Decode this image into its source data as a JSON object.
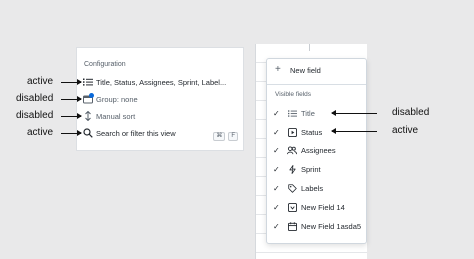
{
  "configuration_menu": {
    "heading": "Configuration",
    "items": [
      {
        "label": "Title, Status, Assignees, Sprint, Label...",
        "icon": "list-icon",
        "annotation": "active"
      },
      {
        "label": "Group: none",
        "icon": "group-icon",
        "annotation": "disabled"
      },
      {
        "label": "Manual sort",
        "icon": "sort-icon",
        "annotation": "disabled"
      },
      {
        "label": "Search or filter this view",
        "icon": "search-icon",
        "annotation": "active",
        "shortcut": [
          "⌘",
          "F"
        ]
      }
    ]
  },
  "fields_menu": {
    "new_field_label": "New field",
    "visible_heading": "Visible fields",
    "fields": [
      {
        "label": "Title",
        "icon": "list-icon",
        "annotation": "disabled"
      },
      {
        "label": "Status",
        "icon": "status-icon",
        "annotation": "active"
      },
      {
        "label": "Assignees",
        "icon": "people-icon"
      },
      {
        "label": "Sprint",
        "icon": "iteration-icon"
      },
      {
        "label": "Labels",
        "icon": "tag-icon"
      },
      {
        "label": "New Field 14",
        "icon": "single-select-icon"
      },
      {
        "label": "New Field 1asda5",
        "icon": "calendar-icon"
      }
    ]
  },
  "colors": {
    "badge": "#0969da",
    "background": "#e9e9ea"
  }
}
